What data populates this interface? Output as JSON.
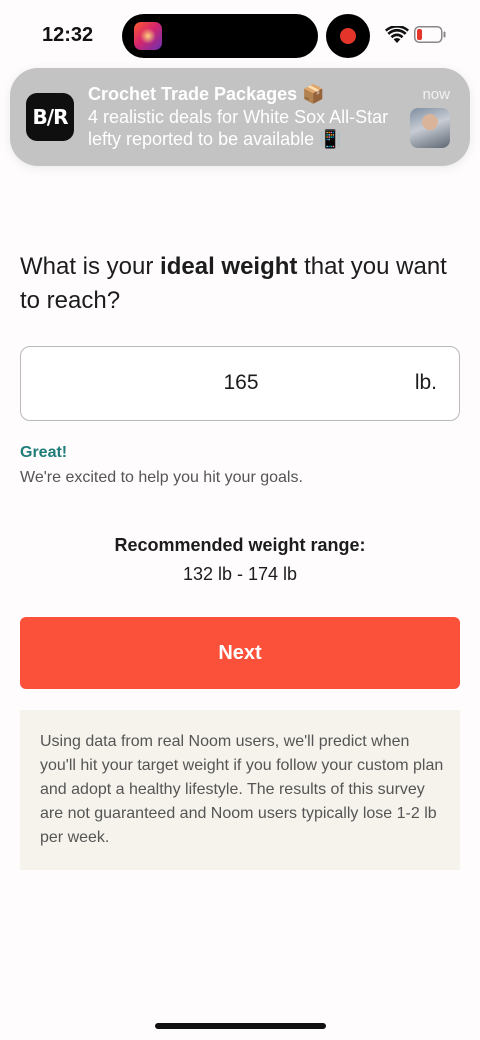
{
  "status_bar": {
    "time": "12:32",
    "island_app_icon": "music-app-icon",
    "recording_indicator_color": "#e5352b",
    "wifi_icon": "wifi-icon",
    "battery_icon": "battery-low-icon",
    "battery_color": "#e5352b"
  },
  "notification": {
    "app_icon_text": "B/R",
    "title": "Crochet Trade Packages 📦",
    "time": "now",
    "body": "4 realistic deals for White Sox All-Star lefty reported to be available 📳",
    "thumbnail": "player-photo-thumbnail"
  },
  "question": {
    "prefix": "What is your ",
    "emphasis": "ideal weight",
    "suffix": " that you want to reach?"
  },
  "weight_input": {
    "value": "165",
    "unit": "lb."
  },
  "feedback": {
    "title": "Great!",
    "text": "We're excited to help you hit your goals."
  },
  "recommended": {
    "title": "Recommended weight range:",
    "range": "132 lb - 174 lb"
  },
  "next_button": {
    "label": "Next",
    "color": "#fb513b"
  },
  "disclaimer": {
    "text": "Using data from real Noom users, we'll predict when you'll hit your target weight if you follow your custom plan and adopt a healthy lifestyle. The results of this survey are not guaranteed and Noom users typically lose 1-2 lb per week."
  },
  "colors": {
    "accent_teal": "#1f7c79",
    "background": "#fefcfd",
    "disclaimer_bg": "#f5f3eb"
  }
}
